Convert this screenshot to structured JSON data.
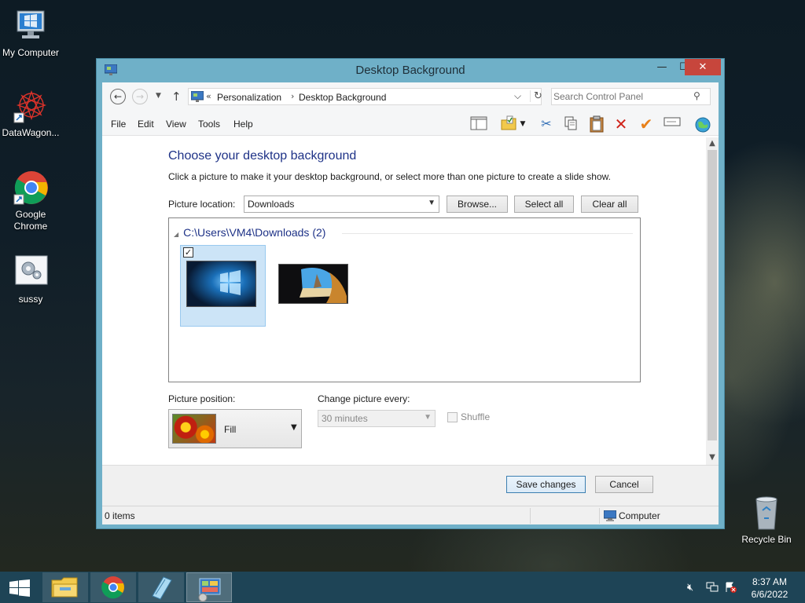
{
  "desktop": {
    "icons": [
      {
        "label": "My Computer"
      },
      {
        "label": "DataWagon..."
      },
      {
        "label": "Google Chrome"
      },
      {
        "label": "sussy"
      },
      {
        "label": "Recycle Bin"
      }
    ]
  },
  "window": {
    "title": "Desktop Background",
    "controls": {
      "minimize": "—",
      "maximize": "☐",
      "close": "✕"
    }
  },
  "navigation": {
    "back_icon": "back-arrow-icon",
    "forward_icon": "forward-arrow-icon",
    "address": {
      "overflow": "«",
      "crumbs": [
        "Personalization",
        "Desktop Background"
      ],
      "separator": "›"
    },
    "search": {
      "placeholder": "Search Control Panel"
    }
  },
  "menu": {
    "items": [
      "File",
      "Edit",
      "View",
      "Tools",
      "Help"
    ]
  },
  "toolbar": {
    "icons": [
      "pane-icon",
      "folder-properties-icon",
      "dropdown-icon",
      "cut-icon",
      "copy-icon",
      "paste-icon",
      "delete-icon",
      "check-icon",
      "rename-icon",
      "globe-icon"
    ]
  },
  "content": {
    "heading": "Choose your desktop background",
    "instructions": "Click a picture to make it your desktop background, or select more than one picture to create a slide show.",
    "picture_location": {
      "label": "Picture location:",
      "value": "Downloads"
    },
    "buttons": {
      "browse": "Browse...",
      "select_all": "Select all",
      "clear_all": "Clear all"
    },
    "gallery": {
      "group_header": "C:\\Users\\VM4\\Downloads (2)",
      "collapse_icon": "◢",
      "pictures": [
        {
          "name": "windows-10-wallpaper",
          "selected": true
        },
        {
          "name": "beach-cave-wallpaper",
          "selected": false
        }
      ]
    },
    "picture_position": {
      "label": "Picture position:",
      "value": "Fill"
    },
    "change_picture": {
      "label": "Change picture every:",
      "value": "30 minutes",
      "disabled": true
    },
    "shuffle": {
      "label": "Shuffle",
      "checked": false,
      "disabled": true
    }
  },
  "footer": {
    "save": "Save changes",
    "cancel": "Cancel"
  },
  "status_bar": {
    "items_count": "0 items",
    "location": "Computer"
  },
  "taskbar": {
    "apps": [
      "File Explorer",
      "Google Chrome",
      "Notepad",
      "Control Panel"
    ],
    "clock": {
      "time": "8:37 AM",
      "date": "6/6/2022"
    }
  }
}
